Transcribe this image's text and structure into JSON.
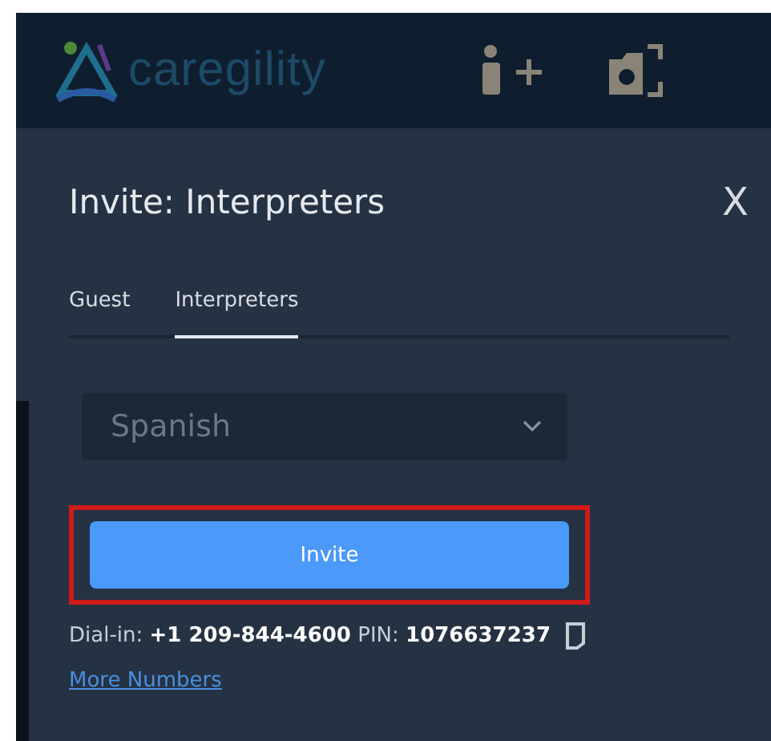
{
  "header": {
    "logo_text": "caregility"
  },
  "panel": {
    "title": "Invite: Interpreters",
    "close": "X"
  },
  "tabs": [
    {
      "label": "Guest",
      "selected": false
    },
    {
      "label": "Interpreters",
      "selected": true
    }
  ],
  "language_select": {
    "value": "Spanish"
  },
  "invite_button": {
    "label": "Invite",
    "highlighted": true
  },
  "dial_in": "Dial-in: **+1 209-844-4600** PIN: **1076637237**",
  "more_numbers_link": "More Numbers"
}
